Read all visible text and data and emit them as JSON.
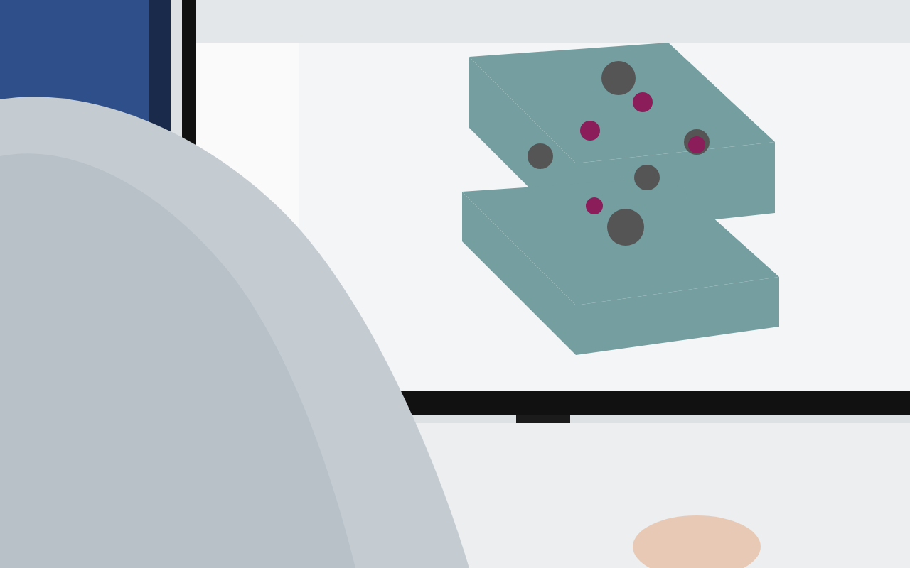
{
  "scene": {
    "kind": "photo"
  }
}
